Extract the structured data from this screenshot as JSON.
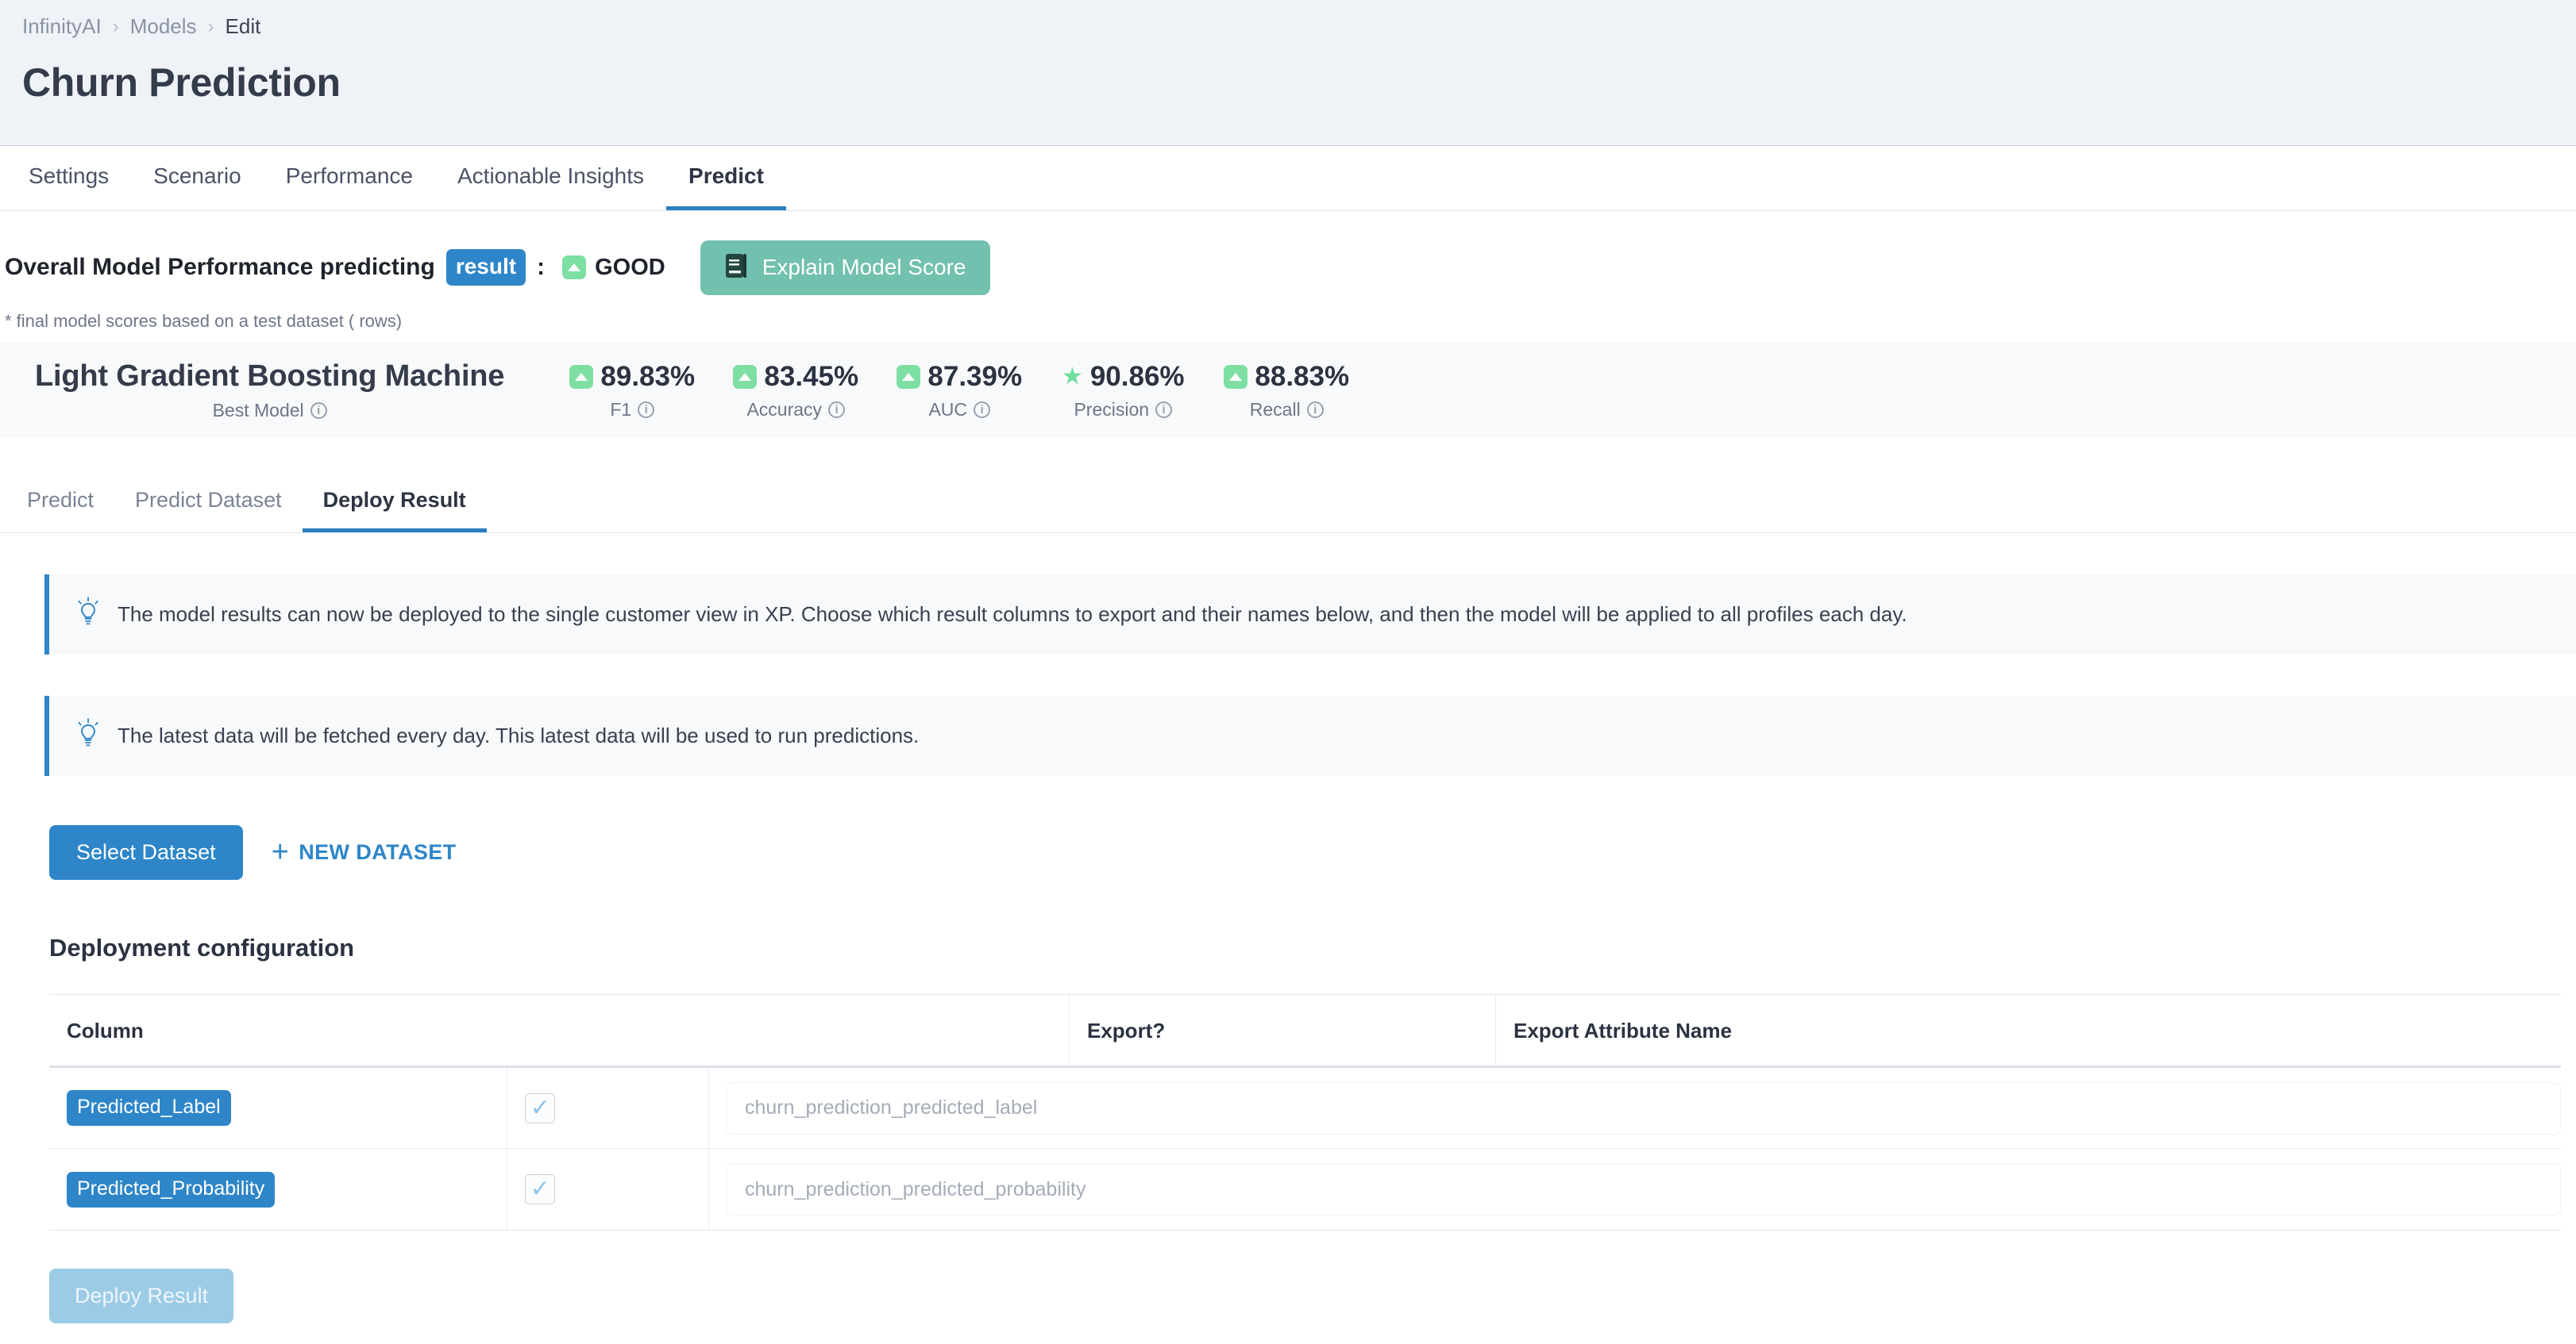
{
  "breadcrumb": {
    "items": [
      "InfinityAI",
      "Models",
      "Edit"
    ],
    "separator": "›"
  },
  "page_title": "Churn Prediction",
  "main_tabs": [
    {
      "label": "Settings",
      "active": false
    },
    {
      "label": "Scenario",
      "active": false
    },
    {
      "label": "Performance",
      "active": false
    },
    {
      "label": "Actionable Insights",
      "active": false
    },
    {
      "label": "Predict",
      "active": true
    }
  ],
  "performance": {
    "headline_prefix": "Overall Model Performance predicting",
    "result_chip": "result",
    "colon": ":",
    "rating": "GOOD",
    "rating_icon": "triangle-up-icon",
    "explain_button": "Explain Model Score",
    "explain_button_icon": "book-icon",
    "footnote": "* final model scores based on a test dataset ( rows)",
    "model_name": "Light Gradient Boosting Machine",
    "model_sub": "Best Model",
    "metrics": [
      {
        "value": "89.83%",
        "label": "F1",
        "icon": "triangle-up-icon"
      },
      {
        "value": "83.45%",
        "label": "Accuracy",
        "icon": "triangle-up-icon"
      },
      {
        "value": "87.39%",
        "label": "AUC",
        "icon": "triangle-up-icon"
      },
      {
        "value": "90.86%",
        "label": "Precision",
        "icon": "star-icon"
      },
      {
        "value": "88.83%",
        "label": "Recall",
        "icon": "triangle-up-icon"
      }
    ]
  },
  "sub_tabs": [
    {
      "label": "Predict",
      "active": false
    },
    {
      "label": "Predict Dataset",
      "active": false
    },
    {
      "label": "Deploy Result",
      "active": true
    }
  ],
  "banners": [
    {
      "icon": "lightbulb-icon",
      "text": "The model results can now be deployed to the single customer view in XP. Choose which result columns to export and their names below, and then the model will be applied to all profiles each day."
    },
    {
      "icon": "lightbulb-icon",
      "text": "The latest data will be fetched every day. This latest data will be used to run predictions."
    }
  ],
  "dataset_actions": {
    "select_dataset": "Select Dataset",
    "new_dataset": "NEW DATASET",
    "new_dataset_icon": "plus-icon"
  },
  "deployment": {
    "section_title": "Deployment configuration",
    "columns": [
      "Column",
      "Export?",
      "Export Attribute Name"
    ],
    "rows": [
      {
        "column": "Predicted_Label",
        "export_checked": true,
        "check_glyph": "✓",
        "attribute_placeholder": "churn_prediction_predicted_label",
        "attribute_value": ""
      },
      {
        "column": "Predicted_Probability",
        "export_checked": true,
        "check_glyph": "✓",
        "attribute_placeholder": "churn_prediction_predicted_probability",
        "attribute_value": ""
      }
    ],
    "deploy_button": "Deploy Result"
  },
  "colors": {
    "accent_blue": "#2e86c9",
    "header_bg": "#eff2f7",
    "strip_bg": "#f8f9fa",
    "good_green": "#7ddfa2",
    "explain_green": "#72c0ae",
    "disabled_blue": "#9ccbe6"
  }
}
